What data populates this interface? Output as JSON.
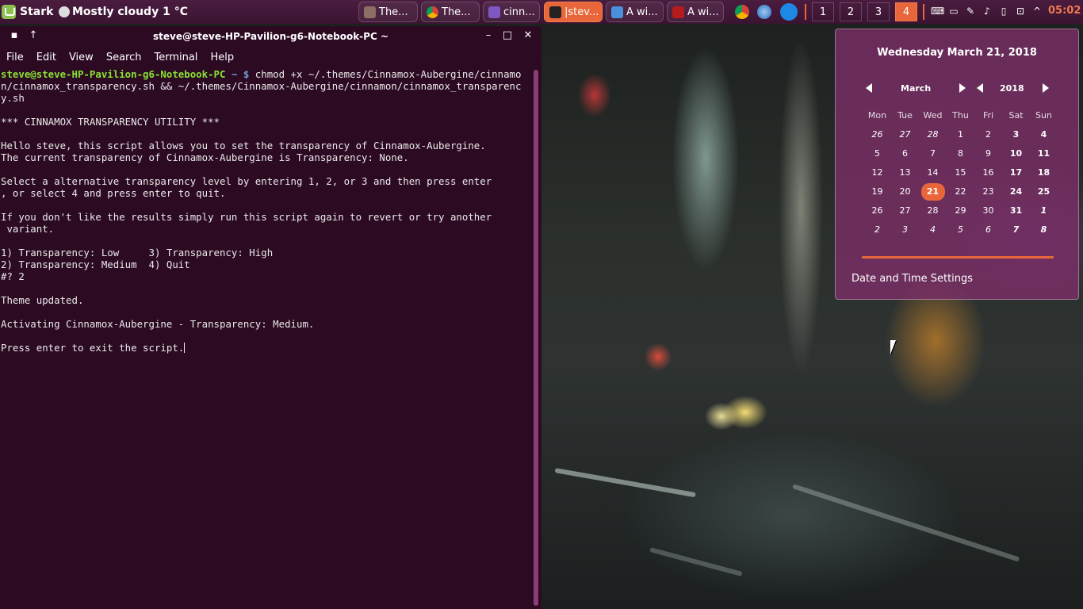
{
  "panel": {
    "menu_label": "Stark",
    "weather": "Mostly cloudy 1 °C",
    "tasks": [
      {
        "label": "The..."
      },
      {
        "label": "The..."
      },
      {
        "label": "cinn..."
      },
      {
        "label": "|stev..."
      },
      {
        "label": "A wi..."
      },
      {
        "label": "A wi..."
      }
    ],
    "workspaces": [
      "1",
      "2",
      "3",
      "4"
    ],
    "clock": "05:02",
    "accent_color": "#e8663a"
  },
  "terminal": {
    "title": "steve@steve-HP-Pavilion-g6-Notebook-PC ~",
    "menu": [
      "File",
      "Edit",
      "View",
      "Search",
      "Terminal",
      "Help"
    ],
    "prompt_user": "steve@steve-HP-Pavilion-g6-Notebook-PC",
    "prompt_path": " ~ $",
    "command": " chmod +x ~/.themes/Cinnamox-Aubergine/cinnamon/cinnamox_transparency.sh && ~/.themes/Cinnamox-Aubergine/cinnamon/cinnamox_transparency.sh",
    "output": "\n*** CINNAMOX TRANSPARENCY UTILITY ***\n\nHello steve, this script allows you to set the transparency of Cinnamox-Aubergine.\nThe current transparency of Cinnamox-Aubergine is Transparency: None.\n\nSelect a alternative transparency level by entering 1, 2, or 3 and then press enter\n, or select 4 and press enter to quit.\n\nIf you don't like the results simply run this script again to revert or try another\n variant.\n\n1) Transparency: Low     3) Transparency: High\n2) Transparency: Medium  4) Quit\n#? 2\n\nTheme updated.\n\nActivating Cinnamox-Aubergine - Transparency: Medium.\n\nPress enter to exit the script.",
    "background_color": "#2c0a22"
  },
  "calendar": {
    "full_date": "Wednesday March 21, 2018",
    "month": "March",
    "year": "2018",
    "weekdays": [
      "Mon",
      "Tue",
      "Wed",
      "Thu",
      "Fri",
      "Sat",
      "Sun"
    ],
    "weeks": [
      [
        "26",
        "27",
        "28",
        "1",
        "2",
        "3",
        "4"
      ],
      [
        "5",
        "6",
        "7",
        "8",
        "9",
        "10",
        "11"
      ],
      [
        "12",
        "13",
        "14",
        "15",
        "16",
        "17",
        "18"
      ],
      [
        "19",
        "20",
        "21",
        "22",
        "23",
        "24",
        "25"
      ],
      [
        "26",
        "27",
        "28",
        "29",
        "30",
        "31",
        "1"
      ],
      [
        "2",
        "3",
        "4",
        "5",
        "6",
        "7",
        "8"
      ]
    ],
    "today": "21",
    "settings_label": "Date and Time Settings"
  }
}
